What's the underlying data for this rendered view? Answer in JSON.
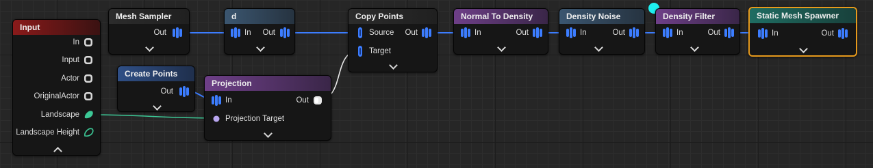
{
  "colors": {
    "wire_points": "#3c7dff",
    "wire_landscape": "#3cc896",
    "wire_projection": "#e8e8e8",
    "header_input": "#8a1a1a",
    "header_sampler": "#2c2c2c",
    "header_subgraph": "#3b5670",
    "header_spatial": "#2f4f86",
    "header_density": "#6e3f88",
    "header_spawner": "#1f6d62",
    "selection_outline": "#e79a1c",
    "selection_dot": "#1ef0f0"
  },
  "nodes": {
    "input": {
      "title": "Input",
      "pins": [
        "In",
        "Input",
        "Actor",
        "OriginalActor",
        "Landscape",
        "Landscape Height"
      ]
    },
    "mesh_sampler": {
      "title": "Mesh Sampler",
      "out": "Out"
    },
    "d": {
      "title": "d",
      "in": "In",
      "out": "Out"
    },
    "create_points": {
      "title": "Create Points",
      "out": "Out"
    },
    "projection": {
      "title": "Projection",
      "in": "In",
      "out": "Out",
      "target": "Projection Target"
    },
    "copy_points": {
      "title": "Copy Points",
      "source": "Source",
      "target": "Target",
      "out": "Out"
    },
    "normal_to_density": {
      "title": "Normal To Density",
      "in": "In",
      "out": "Out"
    },
    "density_noise": {
      "title": "Density Noise",
      "in": "In",
      "out": "Out"
    },
    "density_filter": {
      "title": "Density Filter",
      "in": "In",
      "out": "Out"
    },
    "static_mesh_spawner": {
      "title": "Static Mesh Spawner",
      "in": "In",
      "out": "Out"
    }
  }
}
